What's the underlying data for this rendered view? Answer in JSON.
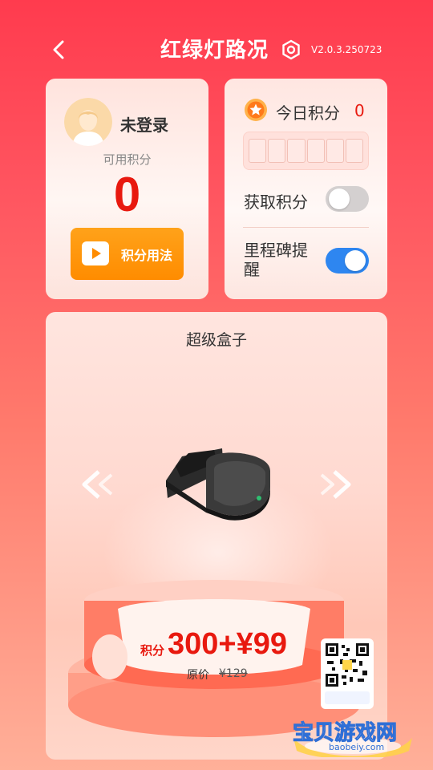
{
  "header": {
    "title": "红绿灯路况",
    "version": "V2.0.3.250723",
    "back_icon": "chevron-left-icon",
    "settings_icon": "hexagon-gear-icon"
  },
  "user_card": {
    "login_status": "未登录",
    "available_points_label": "可用积分",
    "available_points_value": "0",
    "usage_button_label": "积分用法"
  },
  "today_card": {
    "today_label": "今日积分",
    "today_value": "0",
    "digit_slot_count": 6,
    "get_points_label": "获取积分",
    "get_points_toggle": false,
    "milestone_label": "里程碑提醒",
    "milestone_toggle": true
  },
  "product": {
    "title": "超级盒子",
    "price_prefix": "积分",
    "price_main": "300+¥99",
    "original_label": "原价",
    "original_price": "¥129"
  },
  "watermark": {
    "text": "宝贝游戏网",
    "url": "baobeiy.com"
  },
  "colors": {
    "accent_red": "#e8190f",
    "button_orange": "#ff8c00",
    "toggle_on": "#2e86f0",
    "toggle_off": "#d4d0d0"
  }
}
